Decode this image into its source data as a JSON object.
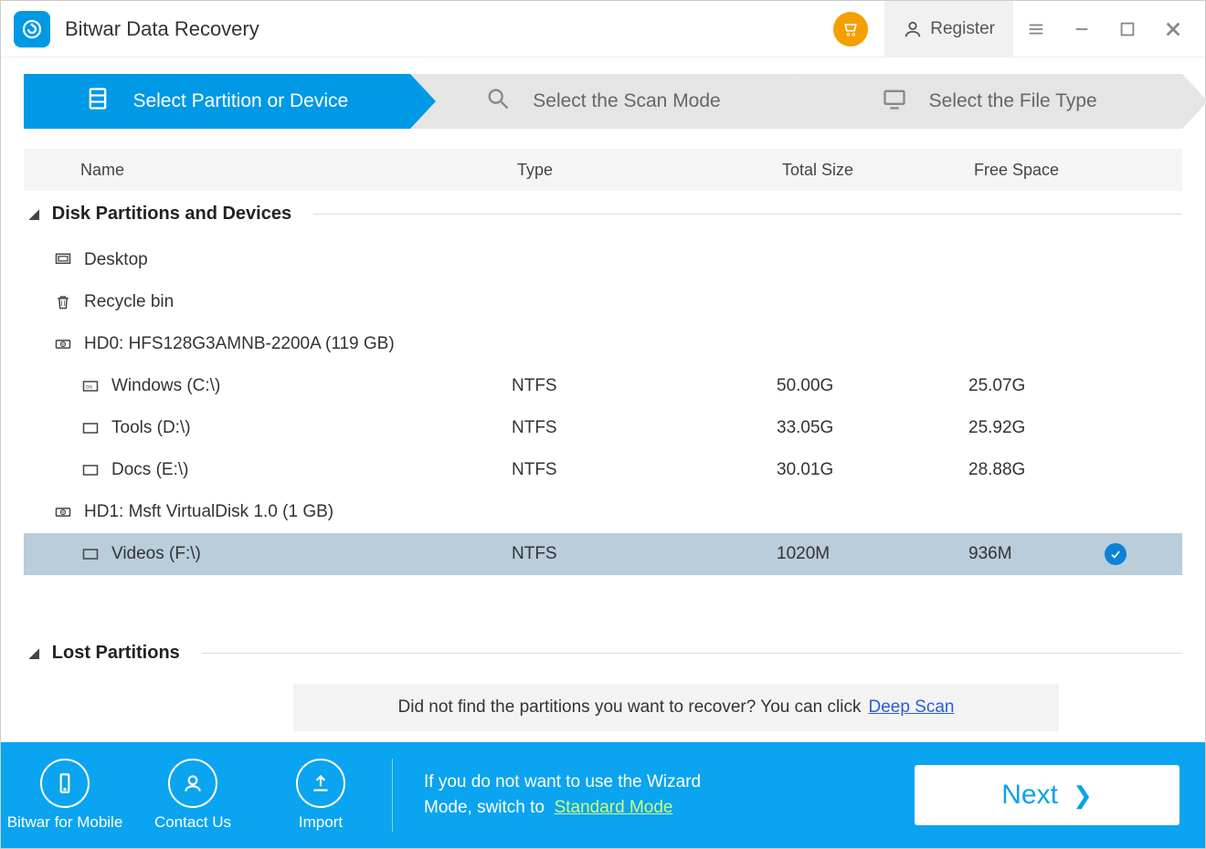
{
  "titlebar": {
    "app_name": "Bitwar Data Recovery",
    "register_label": "Register"
  },
  "wizard": {
    "step1": "Select Partition or Device",
    "step2": "Select the Scan Mode",
    "step3": "Select the File Type"
  },
  "columns": {
    "name": "Name",
    "type": "Type",
    "total": "Total Size",
    "free": "Free Space"
  },
  "section1_title": "Disk Partitions and Devices",
  "desktop_label": "Desktop",
  "recycle_label": "Recycle bin",
  "disk0_label": "HD0: HFS128G3AMNB-2200A (119 GB)",
  "disk1_label": "HD1: Msft VirtualDisk 1.0 (1 GB)",
  "partitions": {
    "c": {
      "name": "Windows (C:\\)",
      "type": "NTFS",
      "total": "50.00G",
      "free": "25.07G"
    },
    "d": {
      "name": "Tools (D:\\)",
      "type": "NTFS",
      "total": "33.05G",
      "free": "25.92G"
    },
    "e": {
      "name": "Docs (E:\\)",
      "type": "NTFS",
      "total": "30.01G",
      "free": "28.88G"
    },
    "f": {
      "name": "Videos (F:\\)",
      "type": "NTFS",
      "total": "1020M",
      "free": "936M"
    }
  },
  "section2_title": "Lost Partitions",
  "banner": {
    "text": "Did not find the partitions you want to recover? You can click",
    "link": "Deep Scan"
  },
  "footer": {
    "mobile": "Bitwar for Mobile",
    "contact": "Contact Us",
    "import": "Import",
    "msg_line1": "If you do not want to use the Wizard",
    "msg_line2a": "Mode, switch to",
    "msg_link": "Standard Mode",
    "next": "Next"
  }
}
